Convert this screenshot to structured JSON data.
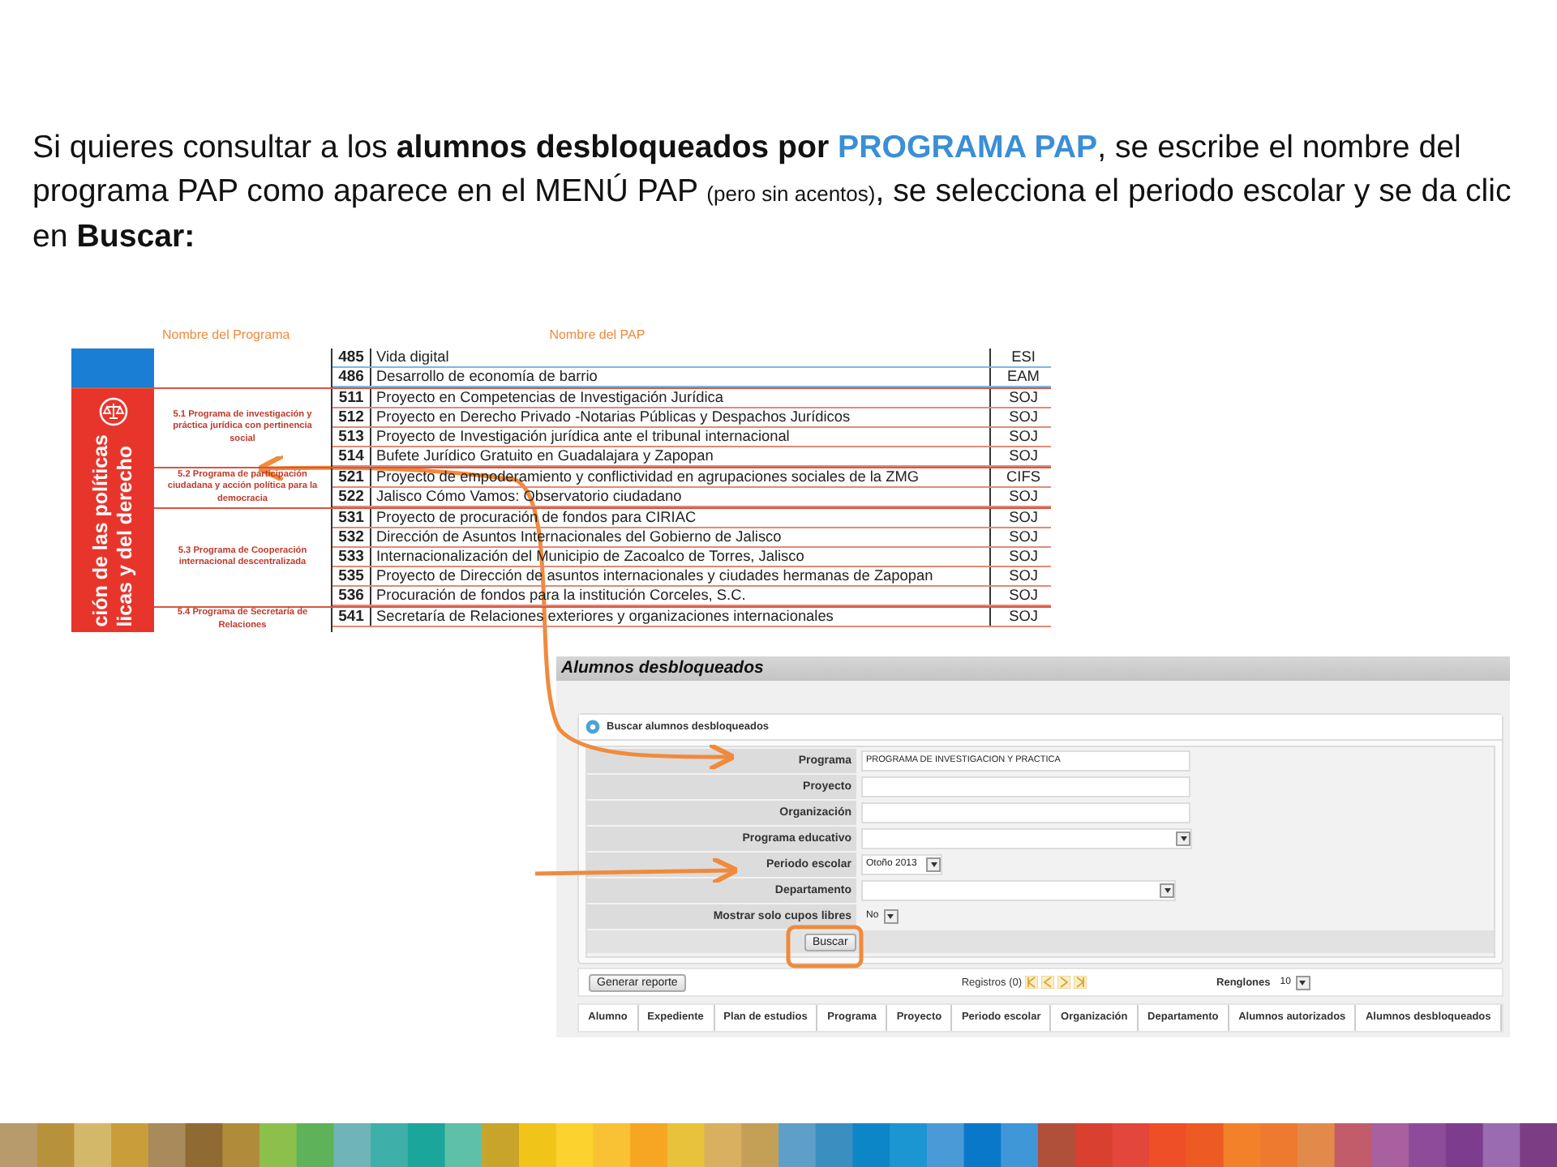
{
  "intro": {
    "segments": [
      {
        "text": "Si quieres consultar a los ",
        "kind": "plain"
      },
      {
        "text": "alumnos desbloqueados por ",
        "kind": "bold"
      },
      {
        "text": "PROGRAMA PAP",
        "kind": "accent"
      },
      {
        "text": ", se escribe el nombre del programa PAP como aparece en el MENÚ PAP ",
        "kind": "plain"
      },
      {
        "text": "(pero sin acentos)",
        "kind": "small"
      },
      {
        "text": ", se selecciona el periodo escolar y se da clic en ",
        "kind": "plain"
      },
      {
        "text": "Buscar:",
        "kind": "bold"
      }
    ]
  },
  "catalog": {
    "column_labels": [
      "Nombre del Programa",
      "Nombre del PAP"
    ],
    "sections": [
      {
        "color": "#1a7fd4",
        "groups": [
          {
            "rows": [
              {
                "number": "485",
                "name": "Vida digital",
                "code": "ESI"
              },
              {
                "number": "486",
                "name": "Desarrollo de economía de barrio",
                "code": "EAM"
              }
            ]
          }
        ]
      },
      {
        "color": "#e8352c",
        "sidebar_lines": [
          "ción de las políticas",
          "licas y del derecho"
        ],
        "groups": [
          {
            "program": "5.1 Programa de investigación y práctica jurídica con pertinencia social",
            "rows": [
              {
                "number": "511",
                "name": "Proyecto en Competencias de Investigación Jurídica",
                "code": "SOJ"
              },
              {
                "number": "512",
                "name": "Proyecto en Derecho Privado -Notarias Públicas y Despachos Jurídicos",
                "code": "SOJ"
              },
              {
                "number": "513",
                "name": "Proyecto de Investigación jurídica ante el tribunal internacional",
                "code": "SOJ"
              },
              {
                "number": "514",
                "name": "Bufete Jurídico Gratuito en Guadalajara y Zapopan",
                "code": "SOJ"
              }
            ]
          },
          {
            "program": "5.2 Programa de participación ciudadana y acción política para la democracia",
            "rows": [
              {
                "number": "521",
                "name": "Proyecto de empoderamiento y conflictividad en agrupaciones sociales de la ZMG",
                "code": "CIFS"
              },
              {
                "number": "522",
                "name": "Jalisco Cómo Vamos: Observatorio ciudadano",
                "code": "SOJ"
              }
            ]
          },
          {
            "program": "5.3 Programa de Cooperación internacional descentralizada",
            "rows": [
              {
                "number": "531",
                "name": "Proyecto de procuración de fondos para CIRIAC",
                "code": "SOJ"
              },
              {
                "number": "532",
                "name": "Dirección de Asuntos Internacionales del Gobierno de Jalisco",
                "code": "SOJ"
              },
              {
                "number": "533",
                "name": "Internacionalización del Municipio de Zacoalco de Torres, Jalisco",
                "code": "SOJ"
              },
              {
                "number": "535",
                "name": "Proyecto de Dirección de asuntos internacionales y ciudades hermanas de Zapopan",
                "code": "SOJ"
              },
              {
                "number": "536",
                "name": "Procuración de fondos para la institución Corceles, S.C.",
                "code": "SOJ"
              }
            ]
          },
          {
            "program": "5.4 Programa de Secretaría de Relaciones",
            "rows": [
              {
                "number": "541",
                "name": "Secretaría de Relaciones exteriores y organizaciones internacionales",
                "code": "SOJ"
              }
            ]
          }
        ]
      }
    ]
  },
  "app": {
    "title": "Alumnos desbloqueados",
    "panel_title": "Buscar alumnos desbloqueados",
    "fields": [
      {
        "label": "Programa",
        "kind": "text",
        "value": "PROGRAMA DE INVESTIGACION Y PRACTICA"
      },
      {
        "label": "Proyecto",
        "kind": "text"
      },
      {
        "label": "Organización",
        "kind": "text"
      },
      {
        "label": "Programa educativo",
        "kind": "select"
      },
      {
        "label": "Periodo escolar",
        "kind": "select",
        "value": "Otoño 2013"
      },
      {
        "label": "Departamento",
        "kind": "select"
      },
      {
        "label": "Mostrar solo cupos libres",
        "kind": "select",
        "value": "No"
      }
    ],
    "search_button": "Buscar",
    "report_button": "Generar reporte",
    "records": "Registros (0)",
    "rows_label": "Renglones",
    "rows_value": "10",
    "columns": [
      "Alumno",
      "Expediente",
      "Plan de estudios",
      "Programa",
      "Proyecto",
      "Periodo escolar",
      "Organización",
      "Departamento",
      "Alumnos autorizados",
      "Alumnos desbloqueados"
    ]
  }
}
